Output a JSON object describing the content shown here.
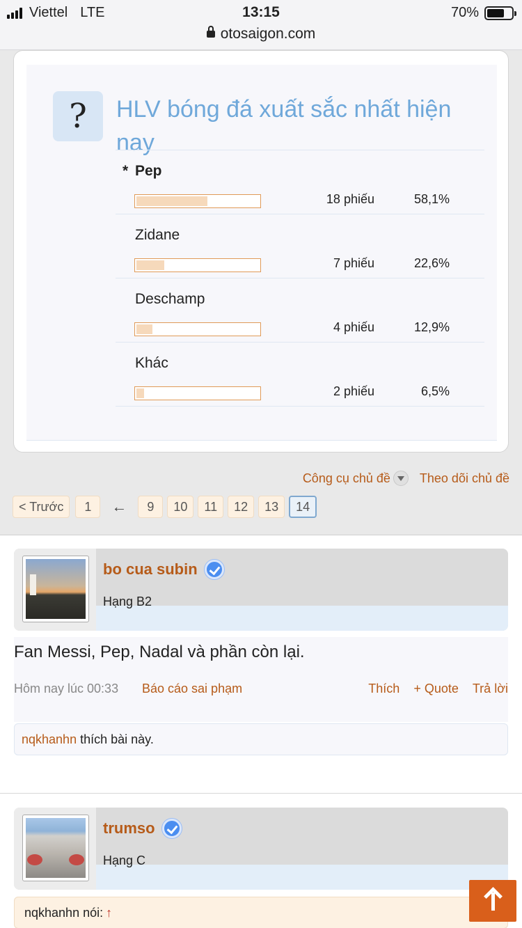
{
  "status_bar": {
    "carrier": "Viettel",
    "network": "LTE",
    "time": "13:15",
    "battery": "70%",
    "battery_level": 0.7,
    "url": "otosaigon.com"
  },
  "poll": {
    "icon_char": "?",
    "title": "HLV bóng đá xuất sắc nhất hiện nay",
    "voted_marker": "*",
    "options": [
      {
        "name": "Pep",
        "votes": "18 phiếu",
        "percent": "58,1%",
        "fraction": 0.581,
        "voted": true
      },
      {
        "name": "Zidane",
        "votes": "7 phiếu",
        "percent": "22,6%",
        "fraction": 0.226,
        "voted": false
      },
      {
        "name": "Deschamp",
        "votes": "4 phiếu",
        "percent": "12,9%",
        "fraction": 0.129,
        "voted": false
      },
      {
        "name": "Khác",
        "votes": "2 phiếu",
        "percent": "6,5%",
        "fraction": 0.065,
        "voted": false
      }
    ]
  },
  "thread_tools": {
    "tools_label": "Công cụ chủ đề",
    "watch_label": "Theo dõi chủ đề"
  },
  "pagination": {
    "prev_label": "< Trước",
    "first_page": "1",
    "jump_arrow": "←",
    "pages": [
      "9",
      "10",
      "11",
      "12",
      "13",
      "14"
    ],
    "current": "14"
  },
  "posts": [
    {
      "username": "bo cua subin",
      "rank": "Hạng B2",
      "text": "Fan Messi, Pep, Nadal và phần còn lại.",
      "date": "Hôm nay lúc 00:33",
      "report": "Báo cáo sai phạm",
      "like": "Thích",
      "quote": "+ Quote",
      "reply": "Trả lời",
      "liker": "nqkhanhn",
      "likes_suffix": "thích bài này."
    },
    {
      "username": "trumso",
      "rank": "Hạng C",
      "quote_author": "nqkhanhn nói:",
      "quote_arrow": "↑"
    }
  ],
  "colors": {
    "link": "#b65b19",
    "poll_title": "#6fa8da",
    "bar_border": "#e09a57",
    "scroll_top": "#d95f1b"
  }
}
